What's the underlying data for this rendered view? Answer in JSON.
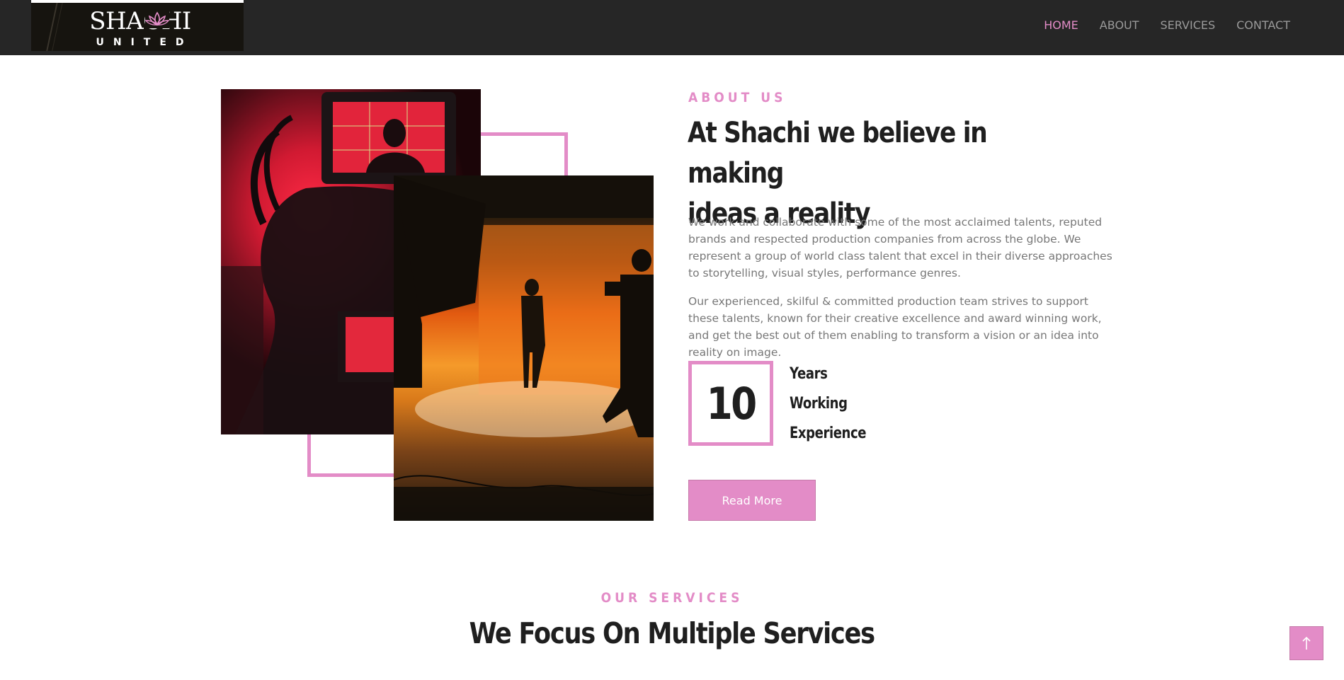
{
  "header": {
    "logo": {
      "name": "SHACHI",
      "subtitle": "UNITED"
    },
    "nav": [
      {
        "label": "HOME",
        "active": true
      },
      {
        "label": "ABOUT",
        "active": false
      },
      {
        "label": "SERVICES",
        "active": false
      },
      {
        "label": "CONTACT",
        "active": false
      }
    ]
  },
  "about": {
    "eyebrow": "ABOUT US",
    "title_line1": "At Shachi we believe in making",
    "title_line2": "ideas a reality",
    "paragraph1": "We work and collaborate with some of the most acclaimed talents, reputed brands and respected production companies from across the globe. We represent a group of world class talent that excel in their diverse approaches to storytelling, visual styles, performance genres.",
    "paragraph2": "Our experienced, skilful & committed production team strives to support these talents, known for their creative excellence and award winning work, and get the best out of them enabling to transform a vision or an idea into reality on image.",
    "years_number": "10",
    "years_line1": "Years",
    "years_line2": "Working",
    "years_line3": "Experience",
    "button_label": "Read More"
  },
  "services": {
    "eyebrow": "OUR SERVICES",
    "title": "We Focus On Multiple Services"
  },
  "colors": {
    "accent": "#e38cc7",
    "header_bg": "#262626",
    "heading": "#1f1f1f",
    "body_text": "#777777"
  },
  "icons": {
    "back_to_top": "arrow-up-icon",
    "logo_mark": "lotus-icon"
  }
}
